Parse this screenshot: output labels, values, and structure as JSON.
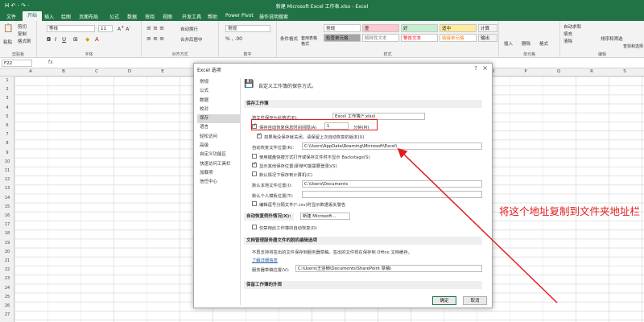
{
  "window": {
    "title": "新建 Microsoft Excel 工作表.xlsx - Excel",
    "quick_access": "H ↶ · ↷ ·"
  },
  "ribbon_tabs": [
    "文件",
    "开始",
    "插入",
    "绘图",
    "页面布局",
    "公式",
    "数据",
    "审阅",
    "视图",
    "开发工具",
    "帮助",
    "Power Pivot",
    "操作说明搜索"
  ],
  "ribbon": {
    "clipboard": {
      "label": "剪贴板",
      "paste": "粘贴",
      "cut": "剪切",
      "copy": "复制",
      "painter": "格式刷"
    },
    "font": {
      "label": "字体",
      "name": "等线",
      "size": "11"
    },
    "alignment": {
      "label": "对齐方式",
      "wrap": "自动换行",
      "merge": "合并后居中"
    },
    "number": {
      "label": "数字",
      "format": "常规"
    },
    "styles": {
      "label": "样式",
      "cond_format": "条件格式",
      "table_format": "套用表格格式",
      "cells": [
        {
          "text": "常规",
          "bg": "#ffffff"
        },
        {
          "text": "差",
          "bg": "#ffc7ce"
        },
        {
          "text": "好",
          "bg": "#c6efce"
        },
        {
          "text": "适中",
          "bg": "#ffeb9c"
        },
        {
          "text": "计算",
          "bg": "#f2f2f2"
        },
        {
          "text": "检查单元格",
          "bg": "#a5a5a5"
        },
        {
          "text": "解释性文本",
          "bg": "#ffffff"
        },
        {
          "text": "警告文本",
          "bg": "#ffffff"
        },
        {
          "text": "链接单元格",
          "bg": "#ffffff"
        },
        {
          "text": "输出",
          "bg": "#f2f2f2"
        }
      ]
    },
    "cells_group": {
      "label": "单元格",
      "insert": "插入",
      "delete": "删除",
      "format": "格式"
    },
    "editing": {
      "label": "编辑",
      "autosum": "自动求和",
      "fill": "填充",
      "clear": "清除",
      "sort": "排序和筛选",
      "find": "查找和选择"
    }
  },
  "formula_bar": {
    "name_box": "F22",
    "fx": "fx"
  },
  "columns": [
    "A",
    "B",
    "C",
    "D",
    "E",
    "F",
    "G",
    "H",
    "I",
    "J",
    "K",
    "L",
    "M",
    "N",
    "O",
    "P",
    "Q",
    "R",
    "S"
  ],
  "rows": [
    "1",
    "2",
    "3",
    "4",
    "5",
    "6",
    "7",
    "8",
    "9",
    "10",
    "11",
    "12",
    "13",
    "14",
    "15",
    "16",
    "17",
    "18",
    "19",
    "20",
    "21",
    "22",
    "23",
    "24",
    "25",
    "26",
    "27"
  ],
  "dialog": {
    "title": "Excel 选项",
    "help": "?",
    "close": "×",
    "nav": [
      "常规",
      "公式",
      "数据",
      "校对",
      "保存",
      "语言",
      "轻松访问",
      "高级",
      "自定义功能区",
      "快速访问工具栏",
      "加载项",
      "信任中心"
    ],
    "nav_selected_index": 4,
    "header_text": "自定义工作簿的保存方式。",
    "section_save": "保存工作簿",
    "save_format_label": "将文件保存为此格式(E):",
    "save_format_value": "Excel 工作簿(*.xlsx)",
    "autorecover_label": "保存自动恢复信息时间间隔(A)",
    "autorecover_value": "1",
    "minutes": "分钟(M)",
    "keep_last_label": "如果我没保存就关闭，请保留上次自动恢复的版本(U)",
    "autorecover_path_label": "自动恢复文件位置(R):",
    "autorecover_path_value": "C:\\Users\\AppData\\Roaming\\Microsoft\\Excel\\",
    "backstage_label": "使用键盘快捷方式打开或保存文件时不显示 Backstage(S)",
    "more_places_label": "显示其他保存位置(即使可能需要登录)(S)",
    "default_computer_label": "默认情况下保存到计算机(C)",
    "local_file_label": "默认本地文件位置(I):",
    "local_file_value": "C:\\Users\\Documents",
    "personal_template_label": "默认个人模板位置(T):",
    "personal_template_value": "",
    "csv_label": "编辑逗号分隔文件(*.csv)时显示数据丢失警告",
    "section_autorecover_exc": "自动恢复例外情况(X):",
    "autorecover_exc_value": "新建 Microsoft...",
    "disable_autorecover_label": "仅禁用此工作簿的自动恢复(D)",
    "section_offline": "文档管理服务器文件的脱机编辑选项",
    "offline_text": "不再支持将签出的文件保存到服务器草稿。签出的文件现在保存到 Office 文档缓存。",
    "learn_more": "了解详细信息",
    "server_drafts_label": "服务器草稿位置(V):",
    "server_drafts_value": "C:\\Users\\王亚楠\\Documents\\SharePoint 草稿\\",
    "section_appearance": "保留工作簿的外观",
    "ok": "确定",
    "cancel": "取消"
  },
  "annotation": {
    "text": "将这个地址复制到文件夹地址栏",
    "color": "#e21c1c"
  }
}
